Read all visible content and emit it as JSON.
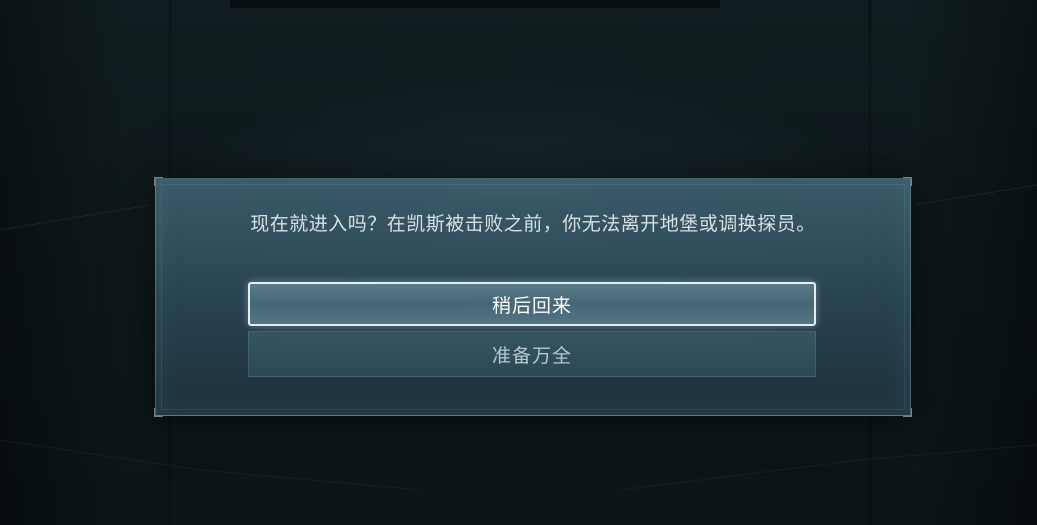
{
  "dialog": {
    "message": "现在就进入吗？在凯斯被击败之前，你无法离开地堡或调换探员。",
    "buttons": {
      "primary_label": "稍后回来",
      "secondary_label": "准备万全"
    }
  },
  "colors": {
    "background": "#0d1719",
    "dialog_fill": "#2e4a58",
    "dialog_border": "#96becd",
    "primary_button_border": "#e3eef2",
    "message_text": "#d6e0e4"
  }
}
